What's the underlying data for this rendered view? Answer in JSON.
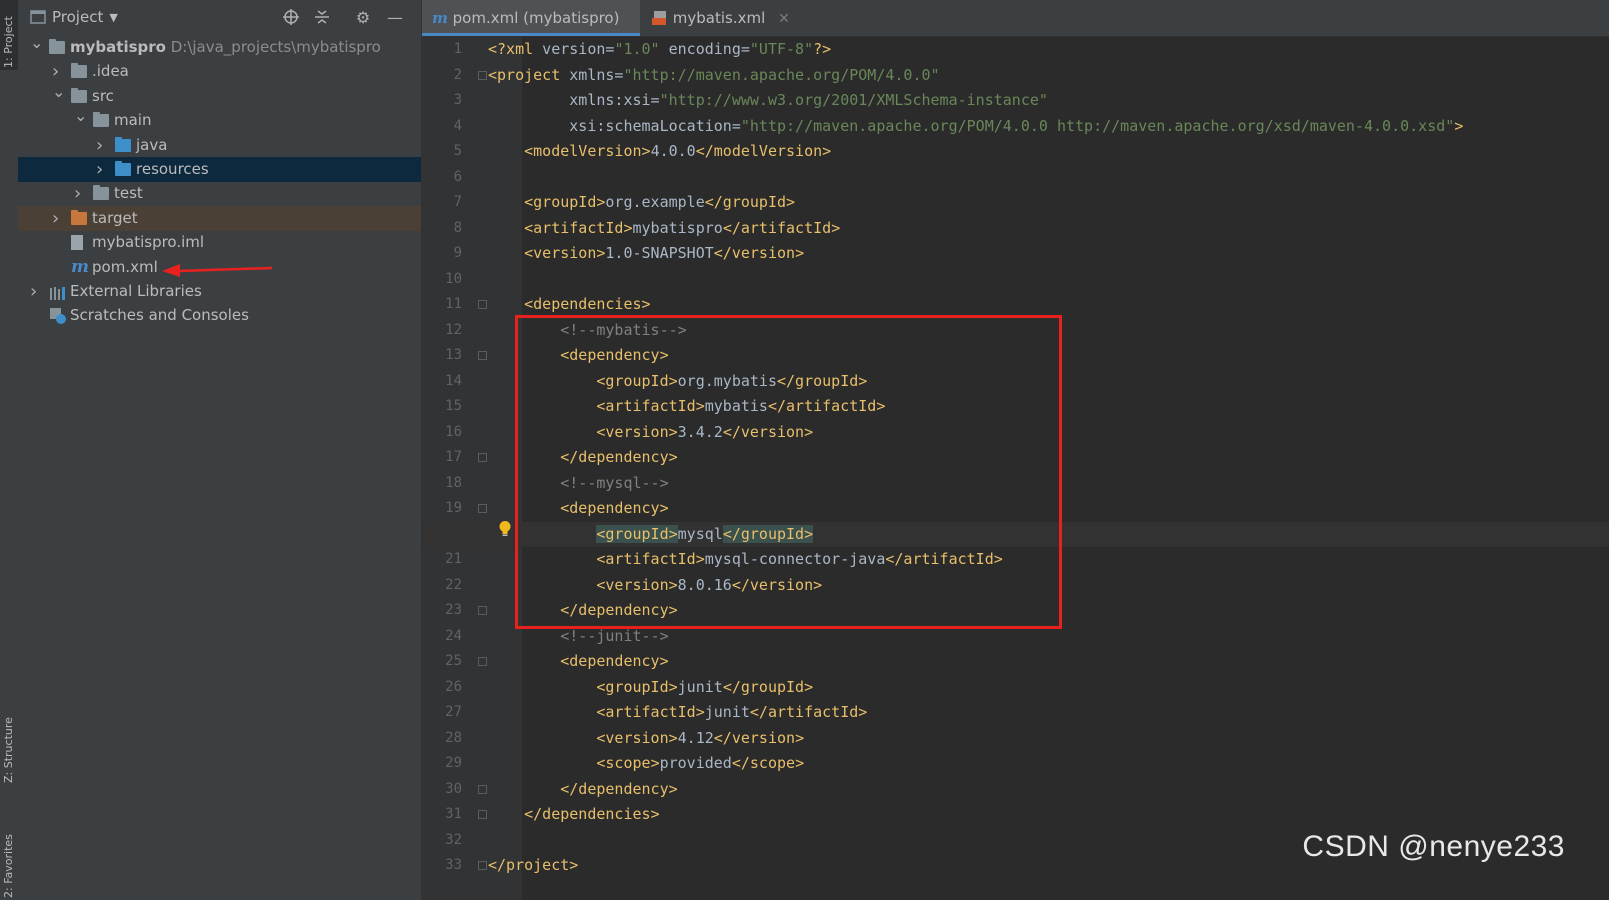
{
  "tool_strip": {
    "project_tab": "1: Project",
    "structure_tab": "Z: Structure",
    "favorites_tab": "2: Favorites"
  },
  "project_panel": {
    "title": "Project",
    "tree": [
      {
        "label": "mybatispro",
        "path": "D:\\java_projects\\mybatispro",
        "depth": 0,
        "expanded": true,
        "icon": "module-folder-icon"
      },
      {
        "label": ".idea",
        "depth": 1,
        "expanded": false,
        "icon": "folder-icon"
      },
      {
        "label": "src",
        "depth": 1,
        "expanded": true,
        "icon": "folder-icon"
      },
      {
        "label": "main",
        "depth": 2,
        "expanded": true,
        "icon": "folder-icon"
      },
      {
        "label": "java",
        "depth": 3,
        "expanded": false,
        "icon": "source-folder-icon"
      },
      {
        "label": "resources",
        "depth": 3,
        "expanded": false,
        "icon": "resources-folder-icon",
        "selected": true
      },
      {
        "label": "test",
        "depth": 2,
        "expanded": false,
        "icon": "folder-icon"
      },
      {
        "label": "target",
        "depth": 1,
        "expanded": false,
        "icon": "excluded-folder-icon"
      },
      {
        "label": "mybatispro.iml",
        "depth": 1,
        "icon": "iml-file-icon"
      },
      {
        "label": "pom.xml",
        "depth": 1,
        "icon": "maven-file-icon"
      },
      {
        "label": "External Libraries",
        "depth": 0,
        "expanded": false,
        "icon": "libraries-icon"
      },
      {
        "label": "Scratches and Consoles",
        "depth": 0,
        "icon": "scratches-icon"
      }
    ]
  },
  "editor": {
    "tabs": [
      {
        "label": "pom.xml (mybatispro)",
        "active": true
      },
      {
        "label": "mybatis.xml",
        "active": false
      }
    ],
    "current_line": 20,
    "lines": [
      "<?xml version=\"1.0\" encoding=\"UTF-8\"?>",
      "<project xmlns=\"http://maven.apache.org/POM/4.0.0\"",
      "         xmlns:xsi=\"http://www.w3.org/2001/XMLSchema-instance\"",
      "         xsi:schemaLocation=\"http://maven.apache.org/POM/4.0.0 http://maven.apache.org/xsd/maven-4.0.0.xsd\">",
      "    <modelVersion>4.0.0</modelVersion>",
      "",
      "    <groupId>org.example</groupId>",
      "    <artifactId>mybatispro</artifactId>",
      "    <version>1.0-SNAPSHOT</version>",
      "",
      "    <dependencies>",
      "        <!--mybatis-->",
      "        <dependency>",
      "            <groupId>org.mybatis</groupId>",
      "            <artifactId>mybatis</artifactId>",
      "            <version>3.4.2</version>",
      "        </dependency>",
      "        <!--mysql-->",
      "        <dependency>",
      "            <groupId>mysql</groupId>",
      "            <artifactId>mysql-connector-java</artifactId>",
      "            <version>8.0.16</version>",
      "        </dependency>",
      "        <!--junit-->",
      "        <dependency>",
      "            <groupId>junit</groupId>",
      "            <artifactId>junit</artifactId>",
      "            <version>4.12</version>",
      "            <scope>provided</scope>",
      "        </dependency>",
      "    </dependencies>",
      "",
      "</project>"
    ]
  },
  "watermark": "CSDN @nenye233",
  "colors": {
    "tag": "#e8bf6a",
    "string": "#6a8759",
    "comment": "#808080",
    "namespace": "#9876aa",
    "annotation_box": "#e8201e"
  }
}
